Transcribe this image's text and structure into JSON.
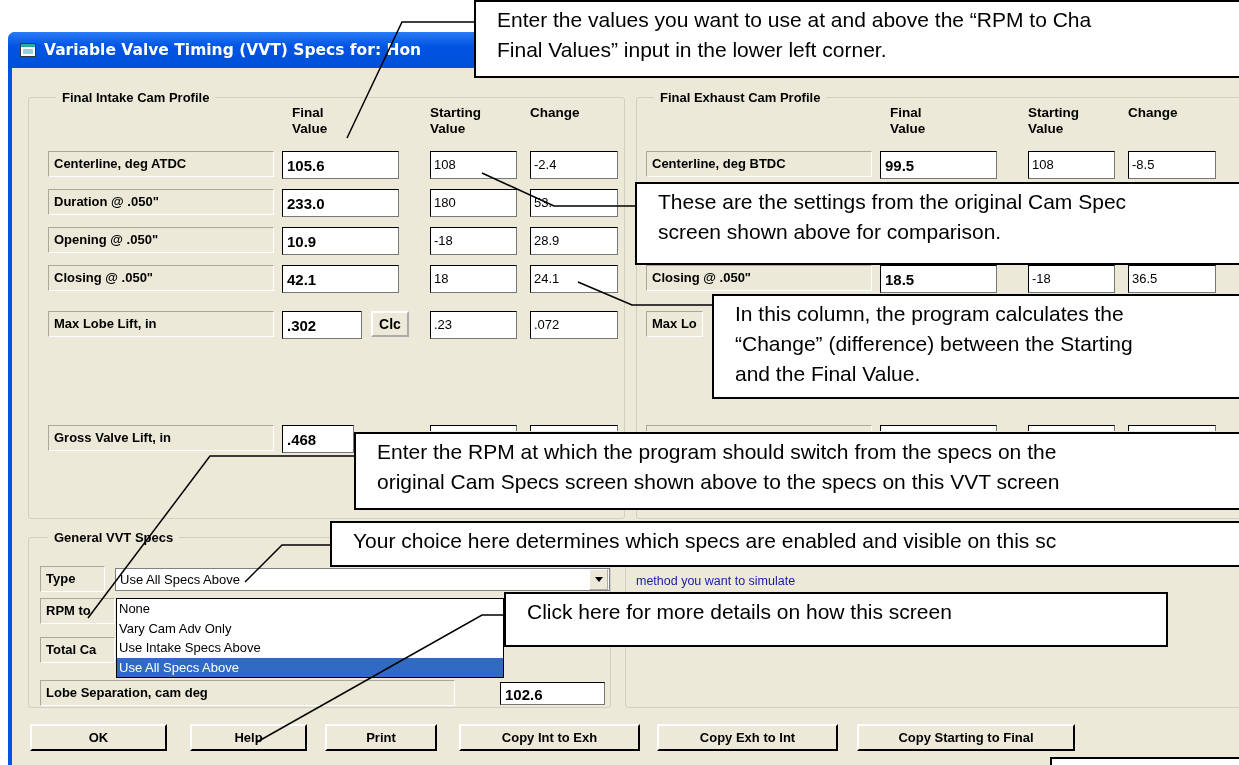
{
  "window": {
    "title": "Variable Valve Timing (VVT) Specs for: Hon"
  },
  "intake": {
    "title": "Final Intake Cam Profile",
    "columns": [
      "Final Value",
      "Starting Value",
      "Change"
    ],
    "rows": [
      {
        "kind": "value",
        "label": "Centerline, deg ATDC",
        "final": "105.6",
        "starting": "108",
        "change": "-2.4"
      },
      {
        "kind": "value",
        "label": "Duration @ .050\"",
        "final": "233.0",
        "starting": "180",
        "change": "53."
      },
      {
        "kind": "value",
        "label": "Opening @ .050\"",
        "final": "10.9",
        "starting": "-18",
        "change": "28.9"
      },
      {
        "kind": "value",
        "label": "Closing @ .050\"",
        "final": "42.1",
        "starting": "18",
        "change": "24.1"
      },
      {
        "kind": "lift",
        "label": "Max Lobe Lift, in",
        "final": ".302",
        "button": "Clc",
        "starting": ".23",
        "change": ".072"
      },
      {
        "kind": "value",
        "label": "Gross Valve Lift, in",
        "final": ".468"
      }
    ]
  },
  "exhaust": {
    "title": "Final Exhaust Cam Profile",
    "columns": [
      "Final Value",
      "Starting Value",
      "Change"
    ],
    "rows": [
      {
        "kind": "value",
        "label": "Centerline, deg BTDC",
        "final": "99.5",
        "starting": "108",
        "change": "-8.5"
      },
      {
        "kind": "covered"
      },
      {
        "kind": "covered"
      },
      {
        "kind": "value",
        "label": "Closing @ .050\"",
        "final": "18.5",
        "starting": "-18",
        "change": "36.5"
      },
      {
        "kind": "value",
        "label": "Max Lo"
      },
      {
        "kind": "value"
      }
    ]
  },
  "general": {
    "title": "General VVT Specs",
    "type_label": "Type",
    "type_value": "Use All Specs Above",
    "options": [
      {
        "label": "None",
        "selected": false
      },
      {
        "label": "Vary Cam Adv Only",
        "selected": false
      },
      {
        "label": "Use Intake Specs Above",
        "selected": false
      },
      {
        "label": "Use All Specs Above",
        "selected": true
      }
    ],
    "rpm_label": "RPM to",
    "total_label": "Total Ca",
    "lobe_label": "Lobe Separation, cam deg",
    "lobe_value": "102.6",
    "note": "method you want to simulate"
  },
  "buttons": [
    "OK",
    "Help",
    "Print",
    "Copy Int to Exh",
    "Copy Exh to Int",
    "Copy Starting to Final"
  ],
  "callouts": [
    {
      "lines": [
        "Enter the values you want to use at and above the “RPM to Cha",
        "Final Values” input in the lower left corner."
      ]
    },
    {
      "lines": [
        "These are the settings from the original Cam Spec",
        "screen shown above for comparison."
      ]
    },
    {
      "lines": [
        "In this column, the program calculates the",
        "“Change” (difference) between the Starting",
        "and the Final Value."
      ]
    },
    {
      "lines": [
        "Enter the RPM at which the program should switch from the specs on the",
        "original Cam Specs screen shown above to the specs on this VVT screen"
      ]
    },
    {
      "lines": [
        "Your choice here determines which specs are enabled and visible on this sc"
      ]
    },
    {
      "lines": [
        "Click here for more details on how this screen"
      ]
    }
  ]
}
